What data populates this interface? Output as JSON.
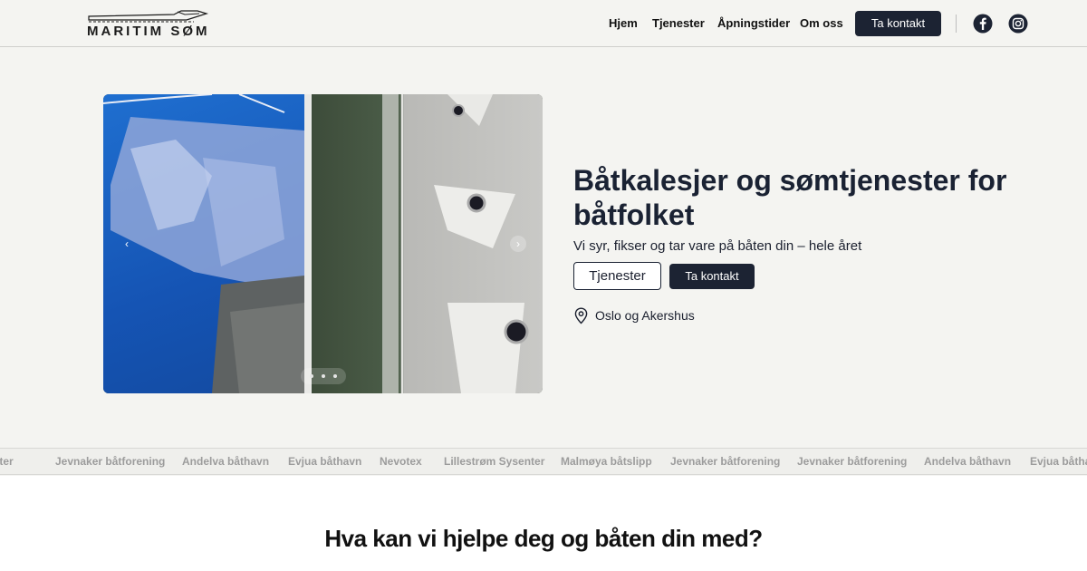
{
  "brand": {
    "name": "MARITIM SØM"
  },
  "nav": {
    "items": [
      {
        "label": "Hjem"
      },
      {
        "label": "Tjenester"
      },
      {
        "label": "Åpningstider"
      },
      {
        "label": "Om oss"
      }
    ],
    "contact_button": "Ta kontakt",
    "social": [
      {
        "icon": "facebook-icon"
      },
      {
        "icon": "instagram-icon"
      }
    ]
  },
  "carousel": {
    "prev_icon": "chevron-left-icon",
    "next_icon": "chevron-right-icon",
    "prev_glyph": "‹",
    "next_glyph": "›",
    "active_slide": 1,
    "slide_count": 3
  },
  "hero": {
    "title": "Båtkalesjer og sømtjenester for båtfolket",
    "subtitle": "Vi syr, fikser og tar vare på båten din – hele året",
    "primary_button": "Tjenester",
    "secondary_button": "Ta kontakt",
    "location_icon": "map-pin-icon",
    "location": "Oslo og Akershus"
  },
  "partners": [
    "Sysenter",
    "Jevnaker båtforening",
    "Andelva båthavn",
    "Evjua båthavn",
    "Nevotex",
    "Lillestrøm Sysenter",
    "Malmøya båtslipp",
    "Jevnaker båtforening",
    "Jevnaker båtforening",
    "Andelva båthavn",
    "Evjua båthavn"
  ],
  "section": {
    "title": "Hva kan vi hjelpe deg og båten din med?"
  },
  "colors": {
    "background": "#f4f4f1",
    "primary": "#1c2333",
    "marquee_text": "#9c9c9c"
  }
}
